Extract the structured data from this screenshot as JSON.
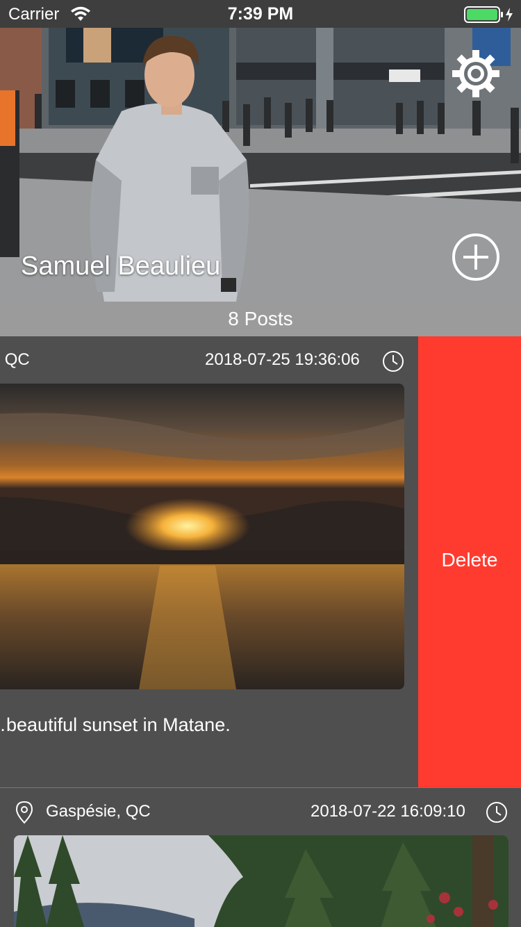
{
  "status_bar": {
    "carrier": "Carrier",
    "time": "7:39 PM"
  },
  "profile": {
    "name": "Samuel Beaulieu",
    "posts_count_label": "8 Posts"
  },
  "posts": [
    {
      "location": "…onne, QC",
      "date": "2018-07-25 19:36:06",
      "caption": "…beautiful sunset in Matane.",
      "image": "sunset-over-water"
    },
    {
      "location": "Gaspésie, QC",
      "date": "2018-07-22 16:09:10",
      "caption": "",
      "image": "forest-trees"
    }
  ],
  "swipe_actions": {
    "delete_label": "Delete"
  },
  "colors": {
    "delete": "#ff3b30",
    "post_background": "#4f4f4f",
    "posts_bar": "#9b9b9b",
    "status_bar": "#3e3e3e",
    "battery": "#4cd964"
  }
}
